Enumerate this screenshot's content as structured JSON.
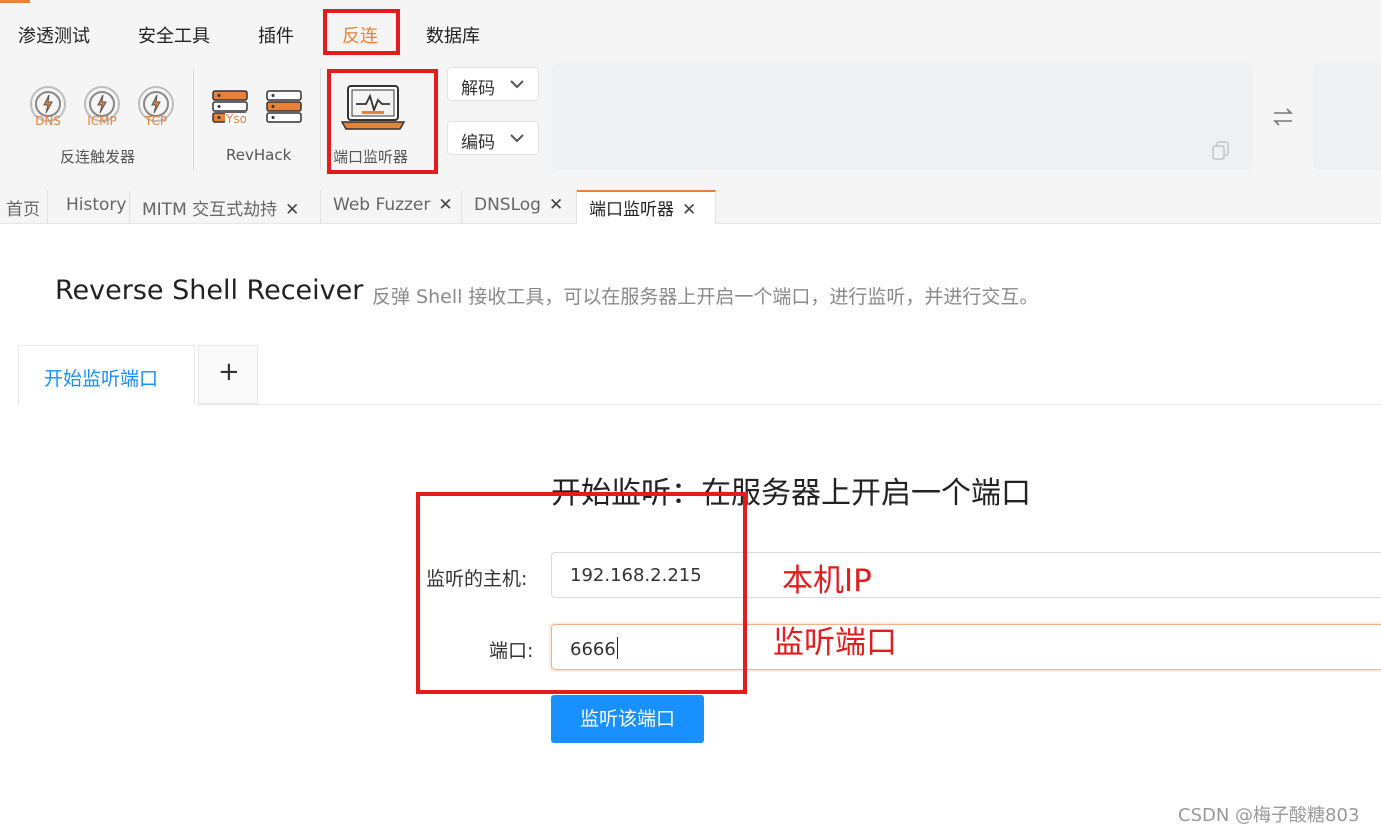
{
  "menu": {
    "items": [
      "渗透测试",
      "安全工具",
      "插件",
      "反连",
      "数据库"
    ],
    "active_index": 3
  },
  "toolbar": {
    "reverse_trigger": {
      "label": "反连触发器",
      "gauges": [
        "DNS",
        "ICMP",
        "TCP"
      ]
    },
    "revhack": {
      "label": "RevHack",
      "yso_badge": "Yso"
    },
    "port_listener": {
      "label": "端口监听器"
    },
    "decode_label": "解码",
    "encode_label": "编码"
  },
  "tabs": [
    {
      "label": "首页",
      "closable": false,
      "active": false
    },
    {
      "label": "History",
      "closable": false,
      "active": false
    },
    {
      "label": "MITM 交互式劫持",
      "closable": true,
      "active": false
    },
    {
      "label": "Web Fuzzer",
      "closable": true,
      "active": false
    },
    {
      "label": "DNSLog",
      "closable": true,
      "active": false
    },
    {
      "label": "端口监听器",
      "closable": true,
      "active": true
    }
  ],
  "page": {
    "title": "Reverse Shell Receiver",
    "subtitle": "反弹 Shell 接收工具，可以在服务器上开启一个端口，进行监听，并进行交互。",
    "inner_tabs": {
      "active_label": "开始监听端口",
      "add_label": "+"
    }
  },
  "form": {
    "title": "开始监听：在服务器上开启一个端口",
    "host_label": "监听的主机:",
    "host_value": "192.168.2.215",
    "port_label": "端口:",
    "port_value": "6666",
    "submit_label": "监听该端口"
  },
  "annotations": {
    "host_note": "本机IP",
    "port_note": "监听端口"
  },
  "watermark": "CSDN @梅子酸糖803",
  "colors": {
    "accent": "#e8823a",
    "primary": "#1890ff",
    "annotation": "#e31c1c"
  }
}
